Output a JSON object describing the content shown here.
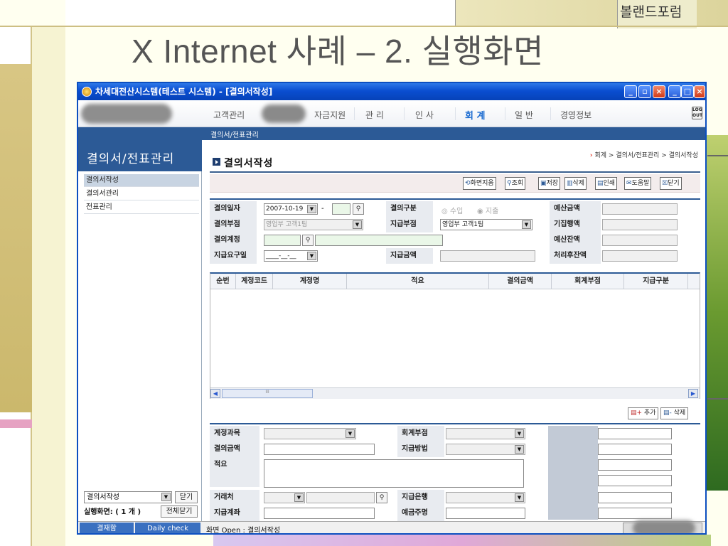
{
  "slide": {
    "title": "X Internet 사례 – 2. 실행화면",
    "corner_text": "볼랜드포럼"
  },
  "window": {
    "title": "차세대전산시스템(테스트 시스템) - [결의서작성]",
    "controls": [
      "_",
      "□",
      "×"
    ]
  },
  "menu": {
    "items": [
      "고객관리",
      "자금지원",
      "관 리",
      "인 사",
      "회 계",
      "일 반",
      "경영정보"
    ],
    "active": "회 계",
    "logout_label": "LOG OUT"
  },
  "subnav": {
    "path": "결의서/전표관리"
  },
  "sidebar": {
    "heading": "결의서/전표관리",
    "items": [
      "결의서작성",
      "결의서관리",
      "전표관리"
    ],
    "selected": "결의서작성",
    "screen_select": "결의서작성",
    "close_label": "닫기",
    "exec_label": "실행화면: ( 1 개 )",
    "close_all_label": "전체닫기"
  },
  "content": {
    "page_title": "결의서작성",
    "breadcrumb": "회계 > 결의서/전표관리 > 결의서작성",
    "toolbar": [
      {
        "icon": "clear-icon",
        "label": "화면지움"
      },
      {
        "icon": "search-icon",
        "label": "조회"
      },
      {
        "icon": "save-icon",
        "label": "저장"
      },
      {
        "icon": "trash-icon",
        "label": "삭제"
      },
      {
        "icon": "print-icon",
        "label": "인쇄"
      },
      {
        "icon": "help-icon",
        "label": "도움말"
      },
      {
        "icon": "close-icon",
        "label": "닫기"
      }
    ]
  },
  "form": {
    "date_label": "결의일자",
    "date_value": "2007-10-19",
    "date_sep": "-",
    "type_label": "결의구분",
    "radio_in": "수입",
    "radio_out": "지출",
    "budget_label": "예산금액",
    "dept_label": "결의부점",
    "dept_value": "영업부 고객1팀",
    "pay_dept_label": "지급부점",
    "pay_dept_value": "영업부 고객1팀",
    "executed_label": "기집행액",
    "account_label": "결의계정",
    "budget_remain_label": "예산잔액",
    "due_label": "지급요구일",
    "due_value": "____-__-__",
    "pay_amount_label": "지급금액",
    "after_remain_label": "처리후잔액"
  },
  "grid": {
    "columns": [
      "순번",
      "계정코드",
      "계정명",
      "적요",
      "결의금액",
      "회계부점",
      "지급구분"
    ],
    "scroll_thumb": "III"
  },
  "buttons": {
    "add": "추가",
    "delete": "삭제"
  },
  "detail": {
    "account_subject": "계정과목",
    "accounting_dept": "회계부점",
    "amount": "결의금액",
    "pay_method": "지급방법",
    "summary": "적요",
    "client": "거래처",
    "pay_bank": "지급은행",
    "pay_account": "지급계좌",
    "depositor": "예금주명"
  },
  "status": {
    "approve_label": "결재함",
    "daily_label": "Daily check",
    "message": "화면 Open : 결의서작성"
  }
}
